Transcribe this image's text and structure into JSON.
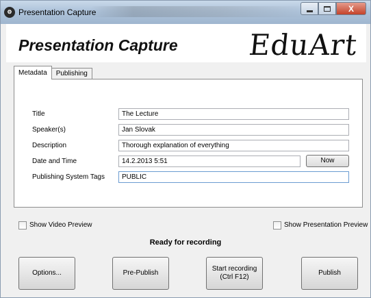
{
  "window": {
    "title": "Presentation Capture",
    "icon_glyph": "⚙",
    "close_glyph": "X"
  },
  "header": {
    "app_title": "Presentation Capture",
    "logo_text": "EduArt"
  },
  "tabs": [
    {
      "label": "Metadata",
      "active": true
    },
    {
      "label": "Publishing",
      "active": false
    }
  ],
  "form": {
    "title_label": "Title",
    "title_value": "The Lecture",
    "speakers_label": "Speaker(s)",
    "speakers_value": "Jan Slovak",
    "description_label": "Description",
    "description_value": "Thorough explanation of everything",
    "datetime_label": "Date and Time",
    "datetime_value": "14.2.2013 5:51",
    "now_button": "Now",
    "tags_label": "Publishing System Tags",
    "tags_value": "PUBLIC"
  },
  "options": {
    "show_video_preview": "Show Video Preview",
    "show_presentation_preview": "Show Presentation Preview"
  },
  "status": "Ready for recording",
  "buttons": {
    "options": "Options...",
    "pre_publish": "Pre-Publish",
    "start_recording_line1": "Start recording",
    "start_recording_line2": "(Ctrl F12)",
    "publish": "Publish"
  }
}
